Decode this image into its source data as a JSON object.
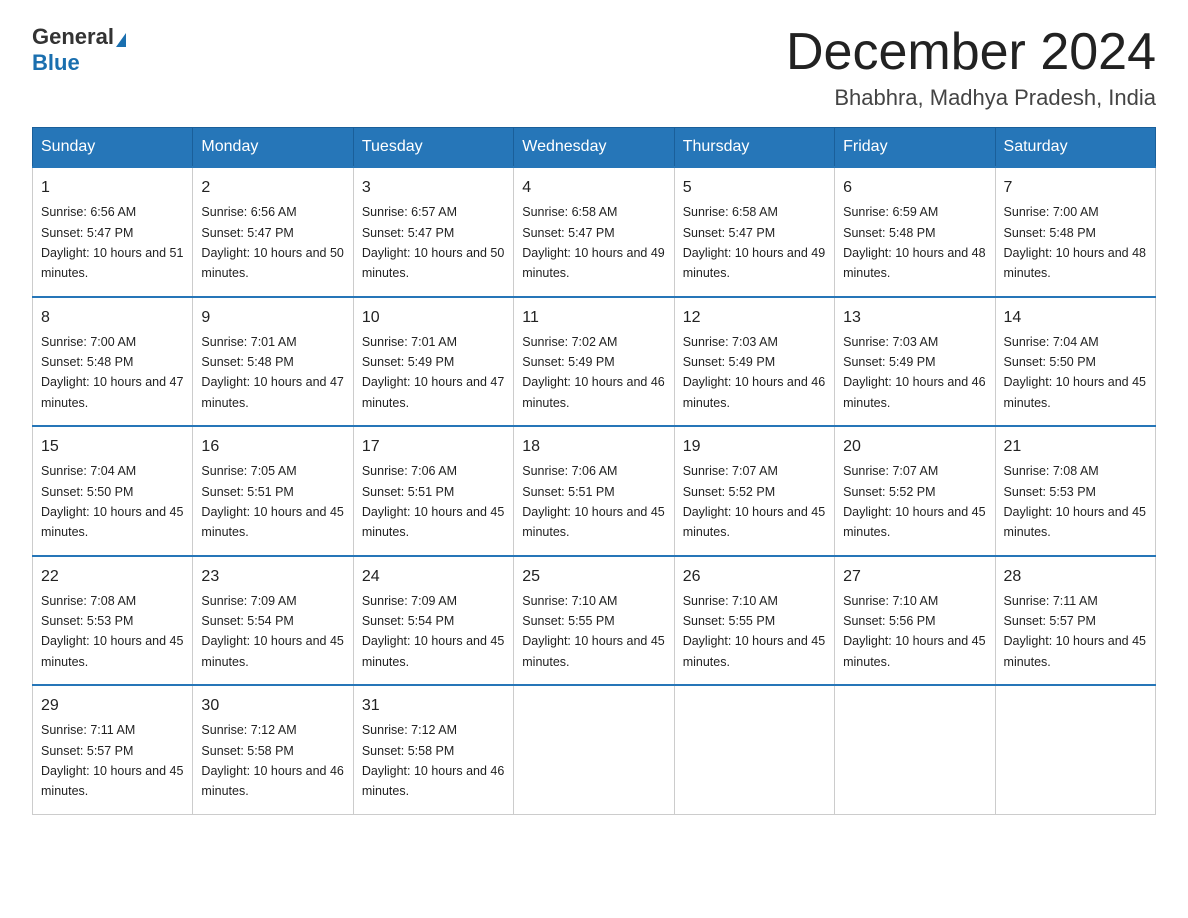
{
  "logo": {
    "general": "General",
    "blue": "Blue"
  },
  "title": "December 2024",
  "subtitle": "Bhabhra, Madhya Pradesh, India",
  "headers": [
    "Sunday",
    "Monday",
    "Tuesday",
    "Wednesday",
    "Thursday",
    "Friday",
    "Saturday"
  ],
  "weeks": [
    [
      {
        "day": "1",
        "sunrise": "6:56 AM",
        "sunset": "5:47 PM",
        "daylight": "10 hours and 51 minutes."
      },
      {
        "day": "2",
        "sunrise": "6:56 AM",
        "sunset": "5:47 PM",
        "daylight": "10 hours and 50 minutes."
      },
      {
        "day": "3",
        "sunrise": "6:57 AM",
        "sunset": "5:47 PM",
        "daylight": "10 hours and 50 minutes."
      },
      {
        "day": "4",
        "sunrise": "6:58 AM",
        "sunset": "5:47 PM",
        "daylight": "10 hours and 49 minutes."
      },
      {
        "day": "5",
        "sunrise": "6:58 AM",
        "sunset": "5:47 PM",
        "daylight": "10 hours and 49 minutes."
      },
      {
        "day": "6",
        "sunrise": "6:59 AM",
        "sunset": "5:48 PM",
        "daylight": "10 hours and 48 minutes."
      },
      {
        "day": "7",
        "sunrise": "7:00 AM",
        "sunset": "5:48 PM",
        "daylight": "10 hours and 48 minutes."
      }
    ],
    [
      {
        "day": "8",
        "sunrise": "7:00 AM",
        "sunset": "5:48 PM",
        "daylight": "10 hours and 47 minutes."
      },
      {
        "day": "9",
        "sunrise": "7:01 AM",
        "sunset": "5:48 PM",
        "daylight": "10 hours and 47 minutes."
      },
      {
        "day": "10",
        "sunrise": "7:01 AM",
        "sunset": "5:49 PM",
        "daylight": "10 hours and 47 minutes."
      },
      {
        "day": "11",
        "sunrise": "7:02 AM",
        "sunset": "5:49 PM",
        "daylight": "10 hours and 46 minutes."
      },
      {
        "day": "12",
        "sunrise": "7:03 AM",
        "sunset": "5:49 PM",
        "daylight": "10 hours and 46 minutes."
      },
      {
        "day": "13",
        "sunrise": "7:03 AM",
        "sunset": "5:49 PM",
        "daylight": "10 hours and 46 minutes."
      },
      {
        "day": "14",
        "sunrise": "7:04 AM",
        "sunset": "5:50 PM",
        "daylight": "10 hours and 45 minutes."
      }
    ],
    [
      {
        "day": "15",
        "sunrise": "7:04 AM",
        "sunset": "5:50 PM",
        "daylight": "10 hours and 45 minutes."
      },
      {
        "day": "16",
        "sunrise": "7:05 AM",
        "sunset": "5:51 PM",
        "daylight": "10 hours and 45 minutes."
      },
      {
        "day": "17",
        "sunrise": "7:06 AM",
        "sunset": "5:51 PM",
        "daylight": "10 hours and 45 minutes."
      },
      {
        "day": "18",
        "sunrise": "7:06 AM",
        "sunset": "5:51 PM",
        "daylight": "10 hours and 45 minutes."
      },
      {
        "day": "19",
        "sunrise": "7:07 AM",
        "sunset": "5:52 PM",
        "daylight": "10 hours and 45 minutes."
      },
      {
        "day": "20",
        "sunrise": "7:07 AM",
        "sunset": "5:52 PM",
        "daylight": "10 hours and 45 minutes."
      },
      {
        "day": "21",
        "sunrise": "7:08 AM",
        "sunset": "5:53 PM",
        "daylight": "10 hours and 45 minutes."
      }
    ],
    [
      {
        "day": "22",
        "sunrise": "7:08 AM",
        "sunset": "5:53 PM",
        "daylight": "10 hours and 45 minutes."
      },
      {
        "day": "23",
        "sunrise": "7:09 AM",
        "sunset": "5:54 PM",
        "daylight": "10 hours and 45 minutes."
      },
      {
        "day": "24",
        "sunrise": "7:09 AM",
        "sunset": "5:54 PM",
        "daylight": "10 hours and 45 minutes."
      },
      {
        "day": "25",
        "sunrise": "7:10 AM",
        "sunset": "5:55 PM",
        "daylight": "10 hours and 45 minutes."
      },
      {
        "day": "26",
        "sunrise": "7:10 AM",
        "sunset": "5:55 PM",
        "daylight": "10 hours and 45 minutes."
      },
      {
        "day": "27",
        "sunrise": "7:10 AM",
        "sunset": "5:56 PM",
        "daylight": "10 hours and 45 minutes."
      },
      {
        "day": "28",
        "sunrise": "7:11 AM",
        "sunset": "5:57 PM",
        "daylight": "10 hours and 45 minutes."
      }
    ],
    [
      {
        "day": "29",
        "sunrise": "7:11 AM",
        "sunset": "5:57 PM",
        "daylight": "10 hours and 45 minutes."
      },
      {
        "day": "30",
        "sunrise": "7:12 AM",
        "sunset": "5:58 PM",
        "daylight": "10 hours and 46 minutes."
      },
      {
        "day": "31",
        "sunrise": "7:12 AM",
        "sunset": "5:58 PM",
        "daylight": "10 hours and 46 minutes."
      },
      null,
      null,
      null,
      null
    ]
  ]
}
